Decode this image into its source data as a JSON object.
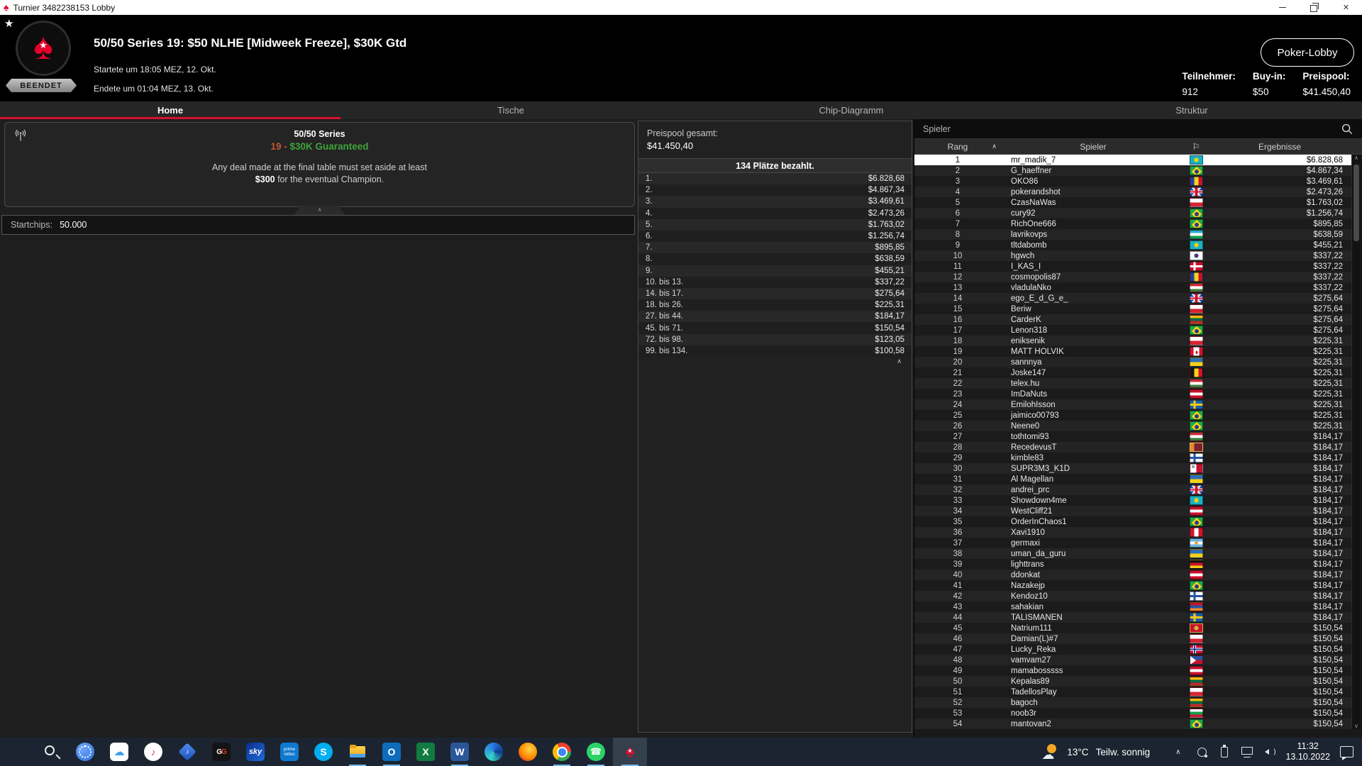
{
  "window": {
    "title": "Turnier 3482238153 Lobby"
  },
  "header": {
    "badge": "BEENDET",
    "title": "50/50 Series 19: $50 NLHE [Midweek Freeze], $30K Gtd",
    "started": "Startete um 18:05 MEZ, 12. Okt.",
    "ended": "Endete um 01:04 MEZ, 13. Okt.",
    "lobby_button": "Poker-Lobby",
    "stats": [
      {
        "label": "Teilnehmer:",
        "value": "912"
      },
      {
        "label": "Buy-in:",
        "value": "$50"
      },
      {
        "label": "Preispool:",
        "value": "$41.450,40"
      }
    ],
    "accent_red": "#e4002b"
  },
  "tabs": [
    {
      "label": "Home",
      "active": true
    },
    {
      "label": "Tische",
      "active": false
    },
    {
      "label": "Chip-Diagramm",
      "active": false
    },
    {
      "label": "Struktur",
      "active": false
    }
  ],
  "tab_underline_color": "#d8112d",
  "info_panel": {
    "series_line1": "50/50 Series",
    "series_prefix": "19 - ",
    "series_main": "$30K Guaranteed",
    "series_prefix_color": "#c25a33",
    "series_main_color": "#3ea43b",
    "deal_line1": "Any deal made at the final table must set aside at least",
    "deal_bold": "$300",
    "deal_rest": " for the eventual Champion.",
    "collapse_glyph": "∧",
    "startchips_label": "Startchips:",
    "startchips_value": "50.000"
  },
  "prizepool_panel": {
    "total_label": "Preispool gesamt:",
    "total_value": "$41.450,40",
    "paid_places": "134 Plätze bezahlt.",
    "scroll_glyph": "∧",
    "payouts": [
      {
        "place": "1.",
        "amount": "$6.828,68"
      },
      {
        "place": "2.",
        "amount": "$4.867,34"
      },
      {
        "place": "3.",
        "amount": "$3.469,61"
      },
      {
        "place": "4.",
        "amount": "$2.473,26"
      },
      {
        "place": "5.",
        "amount": "$1.763,02"
      },
      {
        "place": "6.",
        "amount": "$1.256,74"
      },
      {
        "place": "7.",
        "amount": "$895,85"
      },
      {
        "place": "8.",
        "amount": "$638,59"
      },
      {
        "place": "9.",
        "amount": "$455,21"
      },
      {
        "place": "10. bis 13.",
        "amount": "$337,22"
      },
      {
        "place": "14. bis 17.",
        "amount": "$275,64"
      },
      {
        "place": "18. bis 26.",
        "amount": "$225,31"
      },
      {
        "place": "27. bis 44.",
        "amount": "$184,17"
      },
      {
        "place": "45. bis 71.",
        "amount": "$150,54"
      },
      {
        "place": "72. bis 98.",
        "amount": "$123,05"
      },
      {
        "place": "99. bis 134.",
        "amount": "$100,58"
      }
    ]
  },
  "players_panel": {
    "search_placeholder": "Spieler",
    "columns": {
      "rank": "Rang",
      "player": "Spieler",
      "flag_glyph": "⚐",
      "results": "Ergebnisse",
      "sort_glyph": "∧"
    },
    "scroll_up_glyph": "∧",
    "scroll_down_glyph": "∨",
    "players": [
      {
        "rank": "1",
        "name": "mr_madik_7",
        "country": "kz",
        "prize": "$6.828,68",
        "selected": true
      },
      {
        "rank": "2",
        "name": "G_haeffner",
        "country": "br",
        "prize": "$4.867,34"
      },
      {
        "rank": "3",
        "name": "OKO86",
        "country": "ro",
        "prize": "$3.469,61"
      },
      {
        "rank": "4",
        "name": "pokerandshot",
        "country": "uk",
        "prize": "$2.473,26"
      },
      {
        "rank": "5",
        "name": "CzasNaWas",
        "country": "pl",
        "prize": "$1.763,02"
      },
      {
        "rank": "6",
        "name": "cury92",
        "country": "br",
        "prize": "$1.256,74"
      },
      {
        "rank": "7",
        "name": "RichOne666",
        "country": "br",
        "prize": "$895,85"
      },
      {
        "rank": "8",
        "name": "lavrikovps",
        "country": "uz",
        "prize": "$638,59"
      },
      {
        "rank": "9",
        "name": "tltdabomb",
        "country": "kz",
        "prize": "$455,21"
      },
      {
        "rank": "10",
        "name": "hgwch",
        "country": "kr",
        "prize": "$337,22"
      },
      {
        "rank": "11",
        "name": "I_KAS_I",
        "country": "dk",
        "prize": "$337,22"
      },
      {
        "rank": "12",
        "name": "cosmopolis87",
        "country": "ro",
        "prize": "$337,22"
      },
      {
        "rank": "13",
        "name": "vladulaNko",
        "country": "hu",
        "prize": "$337,22"
      },
      {
        "rank": "14",
        "name": "ego_E_d_G_e_",
        "country": "uk",
        "prize": "$275,64"
      },
      {
        "rank": "15",
        "name": "Beriw",
        "country": "pl",
        "prize": "$275,64"
      },
      {
        "rank": "16",
        "name": "CarderK",
        "country": "lt",
        "prize": "$275,64"
      },
      {
        "rank": "17",
        "name": "Lenon318",
        "country": "br",
        "prize": "$275,64"
      },
      {
        "rank": "18",
        "name": "eniksenik",
        "country": "pl",
        "prize": "$225,31"
      },
      {
        "rank": "19",
        "name": "MATT HOLVIK",
        "country": "ca",
        "prize": "$225,31"
      },
      {
        "rank": "20",
        "name": "sannnya",
        "country": "ua",
        "prize": "$225,31"
      },
      {
        "rank": "21",
        "name": "Joske147",
        "country": "be",
        "prize": "$225,31"
      },
      {
        "rank": "22",
        "name": "telex.hu",
        "country": "hu",
        "prize": "$225,31"
      },
      {
        "rank": "23",
        "name": "ImDaNuts",
        "country": "at",
        "prize": "$225,31"
      },
      {
        "rank": "24",
        "name": "EmilohIsson",
        "country": "se",
        "prize": "$225,31"
      },
      {
        "rank": "25",
        "name": "jaimico00793",
        "country": "br",
        "prize": "$225,31"
      },
      {
        "rank": "26",
        "name": "Neene0",
        "country": "br",
        "prize": "$225,31"
      },
      {
        "rank": "27",
        "name": "tothtomi93",
        "country": "hu",
        "prize": "$184,17"
      },
      {
        "rank": "28",
        "name": "RecedevusT",
        "country": "lk",
        "prize": "$184,17"
      },
      {
        "rank": "29",
        "name": "kimble83",
        "country": "fi",
        "prize": "$184,17"
      },
      {
        "rank": "30",
        "name": "SUPR3M3_K1D",
        "country": "mt",
        "prize": "$184,17"
      },
      {
        "rank": "31",
        "name": "Al Magellan",
        "country": "ua",
        "prize": "$184,17"
      },
      {
        "rank": "32",
        "name": "andrei_prc",
        "country": "uk",
        "prize": "$184,17"
      },
      {
        "rank": "33",
        "name": "Showdown4me",
        "country": "kz",
        "prize": "$184,17"
      },
      {
        "rank": "34",
        "name": "WestCliff21",
        "country": "at",
        "prize": "$184,17"
      },
      {
        "rank": "35",
        "name": "OrderInChaos1",
        "country": "br",
        "prize": "$184,17"
      },
      {
        "rank": "36",
        "name": "Xavi1910",
        "country": "pe",
        "prize": "$184,17"
      },
      {
        "rank": "37",
        "name": "germaxi",
        "country": "ar",
        "prize": "$184,17"
      },
      {
        "rank": "38",
        "name": "uman_da_guru",
        "country": "ua",
        "prize": "$184,17"
      },
      {
        "rank": "39",
        "name": "lighttrans",
        "country": "de",
        "prize": "$184,17"
      },
      {
        "rank": "40",
        "name": "ddonkat",
        "country": "at",
        "prize": "$184,17"
      },
      {
        "rank": "41",
        "name": "Nazakejp",
        "country": "br",
        "prize": "$184,17"
      },
      {
        "rank": "42",
        "name": "Kendoz10",
        "country": "fi",
        "prize": "$184,17"
      },
      {
        "rank": "43",
        "name": "sahakian",
        "country": "am",
        "prize": "$184,17"
      },
      {
        "rank": "44",
        "name": "TALISMANEN",
        "country": "se",
        "prize": "$184,17"
      },
      {
        "rank": "45",
        "name": "Natrium111",
        "country": "me",
        "prize": "$150,54"
      },
      {
        "rank": "46",
        "name": "Damian(L)#7",
        "country": "pl",
        "prize": "$150,54"
      },
      {
        "rank": "47",
        "name": "Lucky_Reka",
        "country": "no",
        "prize": "$150,54"
      },
      {
        "rank": "48",
        "name": "vamvam27",
        "country": "ph",
        "prize": "$150,54"
      },
      {
        "rank": "49",
        "name": "mamabosssss",
        "country": "at",
        "prize": "$150,54"
      },
      {
        "rank": "50",
        "name": "Kepalas89",
        "country": "lt",
        "prize": "$150,54"
      },
      {
        "rank": "51",
        "name": "TadellosPlay",
        "country": "pl",
        "prize": "$150,54"
      },
      {
        "rank": "52",
        "name": "bagoch",
        "country": "lt",
        "prize": "$150,54"
      },
      {
        "rank": "53",
        "name": "noob3r",
        "country": "bg",
        "prize": "$150,54"
      },
      {
        "rank": "54",
        "name": "mantovan2",
        "country": "br",
        "prize": "$150,54"
      }
    ]
  },
  "flags": {
    "kz": {
      "t": "disc",
      "bg": "#19b1c4",
      "disc": "#f4d20f"
    },
    "br": {
      "t": "brazil",
      "bg": "#1fa94a",
      "diamond": "#f8d414",
      "circle": "#2a3b8f"
    },
    "ro": {
      "t": "v",
      "c": [
        "#1b3f9e",
        "#f7d117",
        "#c3122e"
      ]
    },
    "uk": {
      "t": "uk",
      "bg": "#1b3f9e",
      "cross": "#d0142c",
      "white": "#ffffff"
    },
    "pl": {
      "t": "h",
      "c": [
        "#ffffff",
        "#d82333"
      ]
    },
    "uz": {
      "t": "h",
      "c": [
        "#2aa8d8",
        "#ffffff",
        "#14a04a"
      ]
    },
    "kr": {
      "t": "korea",
      "bg": "#ffffff",
      "top": "#d0142c",
      "bottom": "#1b3f9e"
    },
    "dk": {
      "t": "cross",
      "bg": "#c8102e",
      "cross": "#ffffff"
    },
    "hu": {
      "t": "h",
      "c": [
        "#ce2939",
        "#ffffff",
        "#3d7f3f"
      ]
    },
    "lt": {
      "t": "h",
      "c": [
        "#fdba0b",
        "#006a44",
        "#c1272d"
      ]
    },
    "ca": {
      "t": "canada",
      "bg": "#ffffff",
      "side": "#d0142c"
    },
    "ua": {
      "t": "h",
      "c": [
        "#2e6db5",
        "#f7d117"
      ]
    },
    "be": {
      "t": "v",
      "c": [
        "#141414",
        "#f7d117",
        "#d0142c"
      ]
    },
    "at": {
      "t": "h",
      "c": [
        "#c8102e",
        "#ffffff",
        "#c8102e"
      ]
    },
    "se": {
      "t": "cross",
      "bg": "#1c5fa8",
      "cross": "#f7c814"
    },
    "lk": {
      "t": "v",
      "c": [
        "#e8862d",
        "#7b1f32",
        "#7b1f32"
      ],
      "border": "#e7bf4e"
    },
    "fi": {
      "t": "cross",
      "bg": "#ffffff",
      "cross": "#2456a4"
    },
    "mt": {
      "t": "malta",
      "c": [
        "#ffffff",
        "#c8102e"
      ],
      "corner": "#9aa0a6"
    },
    "pe": {
      "t": "v",
      "c": [
        "#d0142c",
        "#ffffff",
        "#d0142c"
      ]
    },
    "ar": {
      "t": "hdisc",
      "c": [
        "#6cb5e3",
        "#ffffff",
        "#6cb5e3"
      ],
      "disc": "#e8a33d"
    },
    "de": {
      "t": "h",
      "c": [
        "#141414",
        "#d0142c",
        "#f7c814"
      ]
    },
    "am": {
      "t": "h",
      "c": [
        "#c8102e",
        "#2456a4",
        "#e8862d"
      ]
    },
    "me": {
      "t": "disc",
      "bg": "#c8102e",
      "disc": "#d4af37",
      "border": "#d4af37"
    },
    "no": {
      "t": "cross2",
      "bg": "#c8102e",
      "outer": "#ffffff",
      "inner": "#22419e"
    },
    "ph": {
      "t": "ph",
      "top": "#2456a4",
      "bottom": "#c8102e",
      "tri": "#ffffff"
    },
    "bg": {
      "t": "h",
      "c": [
        "#ffffff",
        "#14a04a",
        "#d0142c"
      ]
    }
  },
  "taskbar": {
    "apps": [
      {
        "name": "start",
        "running": false,
        "active": false
      },
      {
        "name": "search",
        "running": false,
        "active": false
      },
      {
        "name": "signal",
        "running": false,
        "active": false
      },
      {
        "name": "icloud",
        "running": false,
        "active": false,
        "glyph": "☁"
      },
      {
        "name": "itunes",
        "running": false,
        "active": false,
        "glyph": "♪"
      },
      {
        "name": "video",
        "running": false,
        "active": false,
        "glyph": "♪"
      },
      {
        "name": "gg",
        "running": false,
        "active": false,
        "label": "GG"
      },
      {
        "name": "sky",
        "running": false,
        "active": false,
        "label": "sky"
      },
      {
        "name": "prime",
        "running": false,
        "active": false,
        "label": "prime video"
      },
      {
        "name": "skype",
        "running": false,
        "active": false,
        "label": "S"
      },
      {
        "name": "folder",
        "running": true,
        "active": false
      },
      {
        "name": "outlook",
        "running": true,
        "active": false,
        "label": "O"
      },
      {
        "name": "excel",
        "running": false,
        "active": false,
        "label": "X"
      },
      {
        "name": "word",
        "running": true,
        "active": false,
        "label": "W"
      },
      {
        "name": "edge",
        "running": false,
        "active": false
      },
      {
        "name": "firefox",
        "running": false,
        "active": false
      },
      {
        "name": "chrome",
        "running": true,
        "active": false
      },
      {
        "name": "whatsapp",
        "running": true,
        "active": false,
        "glyph": "☎"
      },
      {
        "name": "pokerstars",
        "running": true,
        "active": true,
        "glyph": "♠",
        "star": "★"
      }
    ],
    "weather": {
      "temp": "13°C",
      "condition": "Teilw. sonnig"
    },
    "tray_chevron": "∧",
    "clock": {
      "time": "11:32",
      "date": "13.10.2022"
    }
  }
}
